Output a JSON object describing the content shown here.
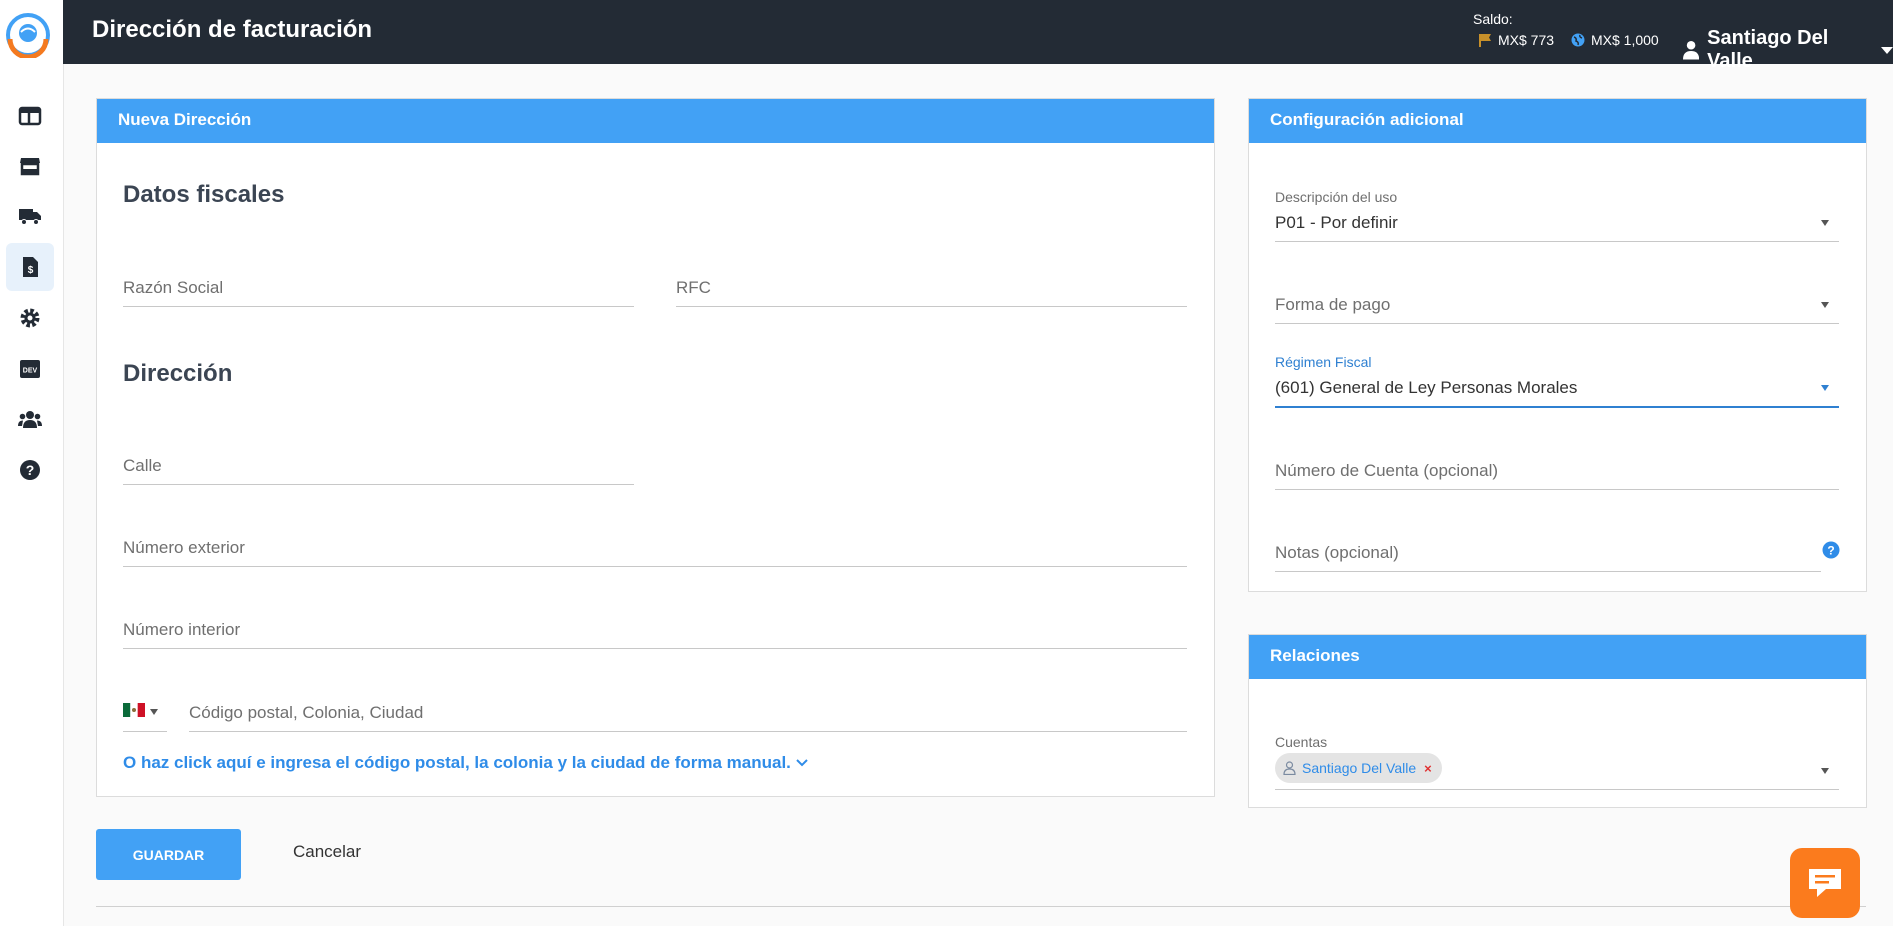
{
  "header": {
    "title": "Dirección de facturación",
    "saldo_label": "Saldo:",
    "balance_local": "MX$ 773",
    "balance_global": "MX$ 1,000",
    "user_name": "Santiago Del Valle"
  },
  "sidebar": {
    "items": [
      {
        "icon": "dashboard-icon"
      },
      {
        "icon": "store-icon"
      },
      {
        "icon": "truck-icon"
      },
      {
        "icon": "invoice-icon",
        "active": true
      },
      {
        "icon": "gear-icon"
      },
      {
        "icon": "dev-icon"
      },
      {
        "icon": "users-icon"
      },
      {
        "icon": "help-icon"
      }
    ]
  },
  "nueva_direccion": {
    "header": "Nueva Dirección",
    "datos_fiscales_title": "Datos fiscales",
    "razon_social_placeholder": "Razón Social",
    "rfc_placeholder": "RFC",
    "direccion_title": "Dirección",
    "calle_placeholder": "Calle",
    "numero_exterior_placeholder": "Número exterior",
    "numero_interior_placeholder": "Número interior",
    "postal_placeholder": "Código postal, Colonia, Ciudad",
    "manual_link": "O haz click aquí e ingresa el código postal, la colonia y la ciudad de forma manual."
  },
  "configuracion": {
    "header": "Configuración adicional",
    "descripcion_label": "Descripción del uso",
    "descripcion_value": "P01 - Por definir",
    "forma_pago_placeholder": "Forma de pago",
    "regimen_label": "Régimen Fiscal",
    "regimen_value": "(601) General de Ley Personas Morales",
    "numero_cuenta_placeholder": "Número de Cuenta (opcional)",
    "notas_placeholder": "Notas (opcional)"
  },
  "relaciones": {
    "header": "Relaciones",
    "cuentas_label": "Cuentas",
    "cuentas_chip": "Santiago Del Valle",
    "chip_remove": "×"
  },
  "actions": {
    "save_label": "GUARDAR",
    "cancel_label": "Cancelar"
  },
  "colors": {
    "accent": "#42a1f5",
    "topbar": "#232b35",
    "chat": "#fb7b1d"
  }
}
